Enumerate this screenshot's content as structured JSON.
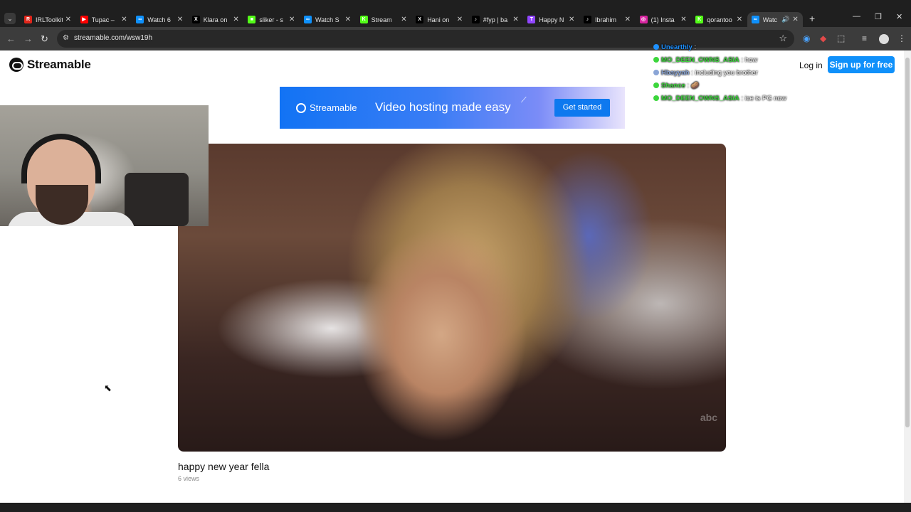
{
  "browser": {
    "tabs": [
      {
        "label": "IRLToolkit",
        "color": "#e0261b",
        "glyph": "R"
      },
      {
        "label": "Tupac –",
        "color": "#ff0000",
        "glyph": "▶"
      },
      {
        "label": "Watch 6",
        "color": "#0f90fa",
        "glyph": "∞"
      },
      {
        "label": "Klara on",
        "color": "#000000",
        "glyph": "X"
      },
      {
        "label": "sliker - s",
        "color": "#53fc18",
        "glyph": "■"
      },
      {
        "label": "Watch S",
        "color": "#0f90fa",
        "glyph": "∞"
      },
      {
        "label": "Stream",
        "color": "#53fc18",
        "glyph": "K"
      },
      {
        "label": "Hani on",
        "color": "#000000",
        "glyph": "X"
      },
      {
        "label": "#fyp | ba",
        "color": "#000000",
        "glyph": "♪"
      },
      {
        "label": "Happy N",
        "color": "#9146ff",
        "glyph": "T"
      },
      {
        "label": "Ibrahim",
        "color": "#000000",
        "glyph": "♪"
      },
      {
        "label": "(1) Insta",
        "color": "#d6249f",
        "glyph": "◎"
      },
      {
        "label": "qorantoo",
        "color": "#53fc18",
        "glyph": "K"
      },
      {
        "label": "Watc",
        "color": "#0f90fa",
        "glyph": "∞"
      }
    ],
    "tab_close_glyph": "✕",
    "new_tab_glyph": "+",
    "url": "streamable.com/wsw19h",
    "icons": {
      "back": "←",
      "forward": "→",
      "reload": "↻",
      "star": "☆",
      "tab_menu": "⌄",
      "minimize": "—",
      "maximize": "❐",
      "close": "✕",
      "menu": "⋮",
      "site_info": "⚙",
      "sound": "🔊"
    }
  },
  "page": {
    "logo_text": "Streamable",
    "login_label": "Log in",
    "signup_label": "Sign up for free",
    "banner": {
      "brand": "Streamable",
      "tagline": "Video hosting made easy",
      "cta": "Get started"
    },
    "video": {
      "title": "happy new year fella",
      "views": "6 views",
      "watermark": "abc"
    }
  },
  "chat": [
    {
      "user": "Unearthly",
      "message": "",
      "color": "#1e90ff"
    },
    {
      "user": "MO_DEEN_OWNS_ASIA",
      "message": "how",
      "color": "#3cd63c"
    },
    {
      "user": "Hbayyah",
      "message": "including you brother",
      "color": "#8aa5d6"
    },
    {
      "user": "Shance",
      "message": "🥔",
      "color": "#3cd63c"
    },
    {
      "user": "MO_DEEN_OWNS_ASIA",
      "message": "ice is PG now",
      "color": "#3cd63c"
    }
  ]
}
